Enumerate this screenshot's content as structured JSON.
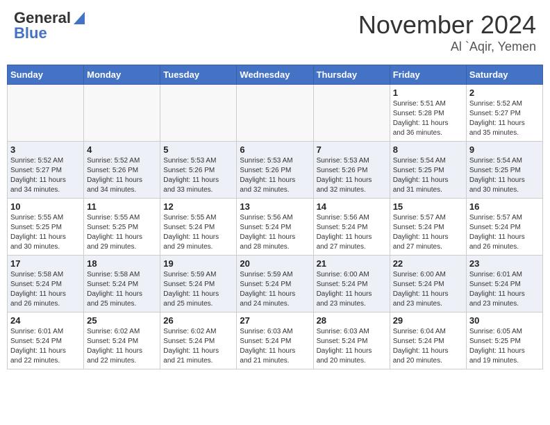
{
  "header": {
    "logo_general": "General",
    "logo_blue": "Blue",
    "month_title": "November 2024",
    "location": "Al `Aqir, Yemen"
  },
  "weekdays": [
    "Sunday",
    "Monday",
    "Tuesday",
    "Wednesday",
    "Thursday",
    "Friday",
    "Saturday"
  ],
  "weeks": [
    [
      {
        "day": "",
        "info": ""
      },
      {
        "day": "",
        "info": ""
      },
      {
        "day": "",
        "info": ""
      },
      {
        "day": "",
        "info": ""
      },
      {
        "day": "",
        "info": ""
      },
      {
        "day": "1",
        "info": "Sunrise: 5:51 AM\nSunset: 5:28 PM\nDaylight: 11 hours\nand 36 minutes."
      },
      {
        "day": "2",
        "info": "Sunrise: 5:52 AM\nSunset: 5:27 PM\nDaylight: 11 hours\nand 35 minutes."
      }
    ],
    [
      {
        "day": "3",
        "info": "Sunrise: 5:52 AM\nSunset: 5:27 PM\nDaylight: 11 hours\nand 34 minutes."
      },
      {
        "day": "4",
        "info": "Sunrise: 5:52 AM\nSunset: 5:26 PM\nDaylight: 11 hours\nand 34 minutes."
      },
      {
        "day": "5",
        "info": "Sunrise: 5:53 AM\nSunset: 5:26 PM\nDaylight: 11 hours\nand 33 minutes."
      },
      {
        "day": "6",
        "info": "Sunrise: 5:53 AM\nSunset: 5:26 PM\nDaylight: 11 hours\nand 32 minutes."
      },
      {
        "day": "7",
        "info": "Sunrise: 5:53 AM\nSunset: 5:26 PM\nDaylight: 11 hours\nand 32 minutes."
      },
      {
        "day": "8",
        "info": "Sunrise: 5:54 AM\nSunset: 5:25 PM\nDaylight: 11 hours\nand 31 minutes."
      },
      {
        "day": "9",
        "info": "Sunrise: 5:54 AM\nSunset: 5:25 PM\nDaylight: 11 hours\nand 30 minutes."
      }
    ],
    [
      {
        "day": "10",
        "info": "Sunrise: 5:55 AM\nSunset: 5:25 PM\nDaylight: 11 hours\nand 30 minutes."
      },
      {
        "day": "11",
        "info": "Sunrise: 5:55 AM\nSunset: 5:25 PM\nDaylight: 11 hours\nand 29 minutes."
      },
      {
        "day": "12",
        "info": "Sunrise: 5:55 AM\nSunset: 5:24 PM\nDaylight: 11 hours\nand 29 minutes."
      },
      {
        "day": "13",
        "info": "Sunrise: 5:56 AM\nSunset: 5:24 PM\nDaylight: 11 hours\nand 28 minutes."
      },
      {
        "day": "14",
        "info": "Sunrise: 5:56 AM\nSunset: 5:24 PM\nDaylight: 11 hours\nand 27 minutes."
      },
      {
        "day": "15",
        "info": "Sunrise: 5:57 AM\nSunset: 5:24 PM\nDaylight: 11 hours\nand 27 minutes."
      },
      {
        "day": "16",
        "info": "Sunrise: 5:57 AM\nSunset: 5:24 PM\nDaylight: 11 hours\nand 26 minutes."
      }
    ],
    [
      {
        "day": "17",
        "info": "Sunrise: 5:58 AM\nSunset: 5:24 PM\nDaylight: 11 hours\nand 26 minutes."
      },
      {
        "day": "18",
        "info": "Sunrise: 5:58 AM\nSunset: 5:24 PM\nDaylight: 11 hours\nand 25 minutes."
      },
      {
        "day": "19",
        "info": "Sunrise: 5:59 AM\nSunset: 5:24 PM\nDaylight: 11 hours\nand 25 minutes."
      },
      {
        "day": "20",
        "info": "Sunrise: 5:59 AM\nSunset: 5:24 PM\nDaylight: 11 hours\nand 24 minutes."
      },
      {
        "day": "21",
        "info": "Sunrise: 6:00 AM\nSunset: 5:24 PM\nDaylight: 11 hours\nand 23 minutes."
      },
      {
        "day": "22",
        "info": "Sunrise: 6:00 AM\nSunset: 5:24 PM\nDaylight: 11 hours\nand 23 minutes."
      },
      {
        "day": "23",
        "info": "Sunrise: 6:01 AM\nSunset: 5:24 PM\nDaylight: 11 hours\nand 23 minutes."
      }
    ],
    [
      {
        "day": "24",
        "info": "Sunrise: 6:01 AM\nSunset: 5:24 PM\nDaylight: 11 hours\nand 22 minutes."
      },
      {
        "day": "25",
        "info": "Sunrise: 6:02 AM\nSunset: 5:24 PM\nDaylight: 11 hours\nand 22 minutes."
      },
      {
        "day": "26",
        "info": "Sunrise: 6:02 AM\nSunset: 5:24 PM\nDaylight: 11 hours\nand 21 minutes."
      },
      {
        "day": "27",
        "info": "Sunrise: 6:03 AM\nSunset: 5:24 PM\nDaylight: 11 hours\nand 21 minutes."
      },
      {
        "day": "28",
        "info": "Sunrise: 6:03 AM\nSunset: 5:24 PM\nDaylight: 11 hours\nand 20 minutes."
      },
      {
        "day": "29",
        "info": "Sunrise: 6:04 AM\nSunset: 5:24 PM\nDaylight: 11 hours\nand 20 minutes."
      },
      {
        "day": "30",
        "info": "Sunrise: 6:05 AM\nSunset: 5:25 PM\nDaylight: 11 hours\nand 19 minutes."
      }
    ]
  ]
}
